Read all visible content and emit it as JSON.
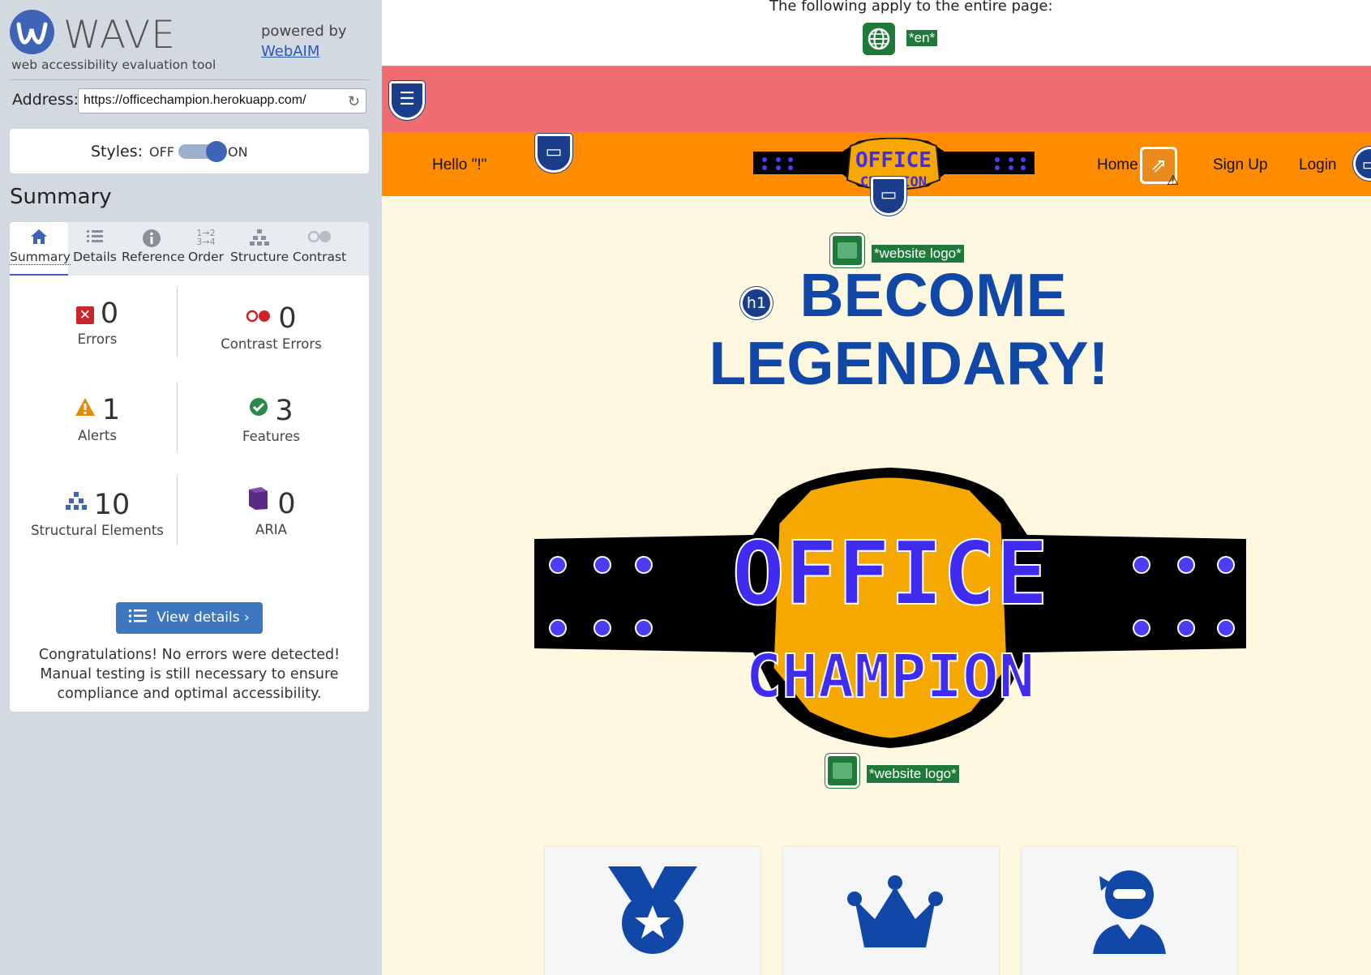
{
  "wave": {
    "logo_text": "WAVE",
    "tagline": "web accessibility evaluation tool",
    "powered_by": "powered by",
    "webaim_link": "WebAIM",
    "address_label": "Address:",
    "address_value": "https://officechampion.herokuapp.com/",
    "styles_label": "Styles:",
    "styles_off": "OFF",
    "styles_on": "ON",
    "summary_title": "Summary",
    "tabs": [
      {
        "label": "Summary",
        "icon": "home-icon"
      },
      {
        "label": "Details",
        "icon": "list-icon"
      },
      {
        "label": "Reference",
        "icon": "info-icon"
      },
      {
        "label": "Order",
        "icon": "order-icon"
      },
      {
        "label": "Structure",
        "icon": "structure-icon"
      },
      {
        "label": "Contrast",
        "icon": "contrast-icon"
      }
    ],
    "stats": {
      "errors": {
        "count": "0",
        "label": "Errors"
      },
      "contrast_errors": {
        "count": "0",
        "label": "Contrast Errors"
      },
      "alerts": {
        "count": "1",
        "label": "Alerts"
      },
      "features": {
        "count": "3",
        "label": "Features"
      },
      "structural": {
        "count": "10",
        "label": "Structural Elements"
      },
      "aria": {
        "count": "0",
        "label": "ARIA"
      }
    },
    "view_details": "View details ›",
    "congrats": "Congratulations! No errors were detected! Manual testing is still necessary to ensure compliance and optimal accessibility."
  },
  "page": {
    "top_note": "The following apply to the entire page:",
    "lang_tag": "*en*",
    "nav": {
      "hello": "Hello \"!\"",
      "home": "Home",
      "signup": "Sign Up",
      "login": "Login"
    },
    "logo_alt_tag": "*website logo*",
    "h1_badge": "h1",
    "hero_line1": "BECOME",
    "hero_line2": "LEGENDARY!",
    "belt_text_top": "OFFICE",
    "belt_text_bottom": "CHAMPION",
    "colors": {
      "accent": "#3e64b5",
      "pink_bar": "#ef6c70",
      "nav_orange": "#ff8c00",
      "hero_blue": "#1148a8",
      "page_bg": "#fff8e1",
      "feature_green": "#1f7a3a"
    }
  }
}
